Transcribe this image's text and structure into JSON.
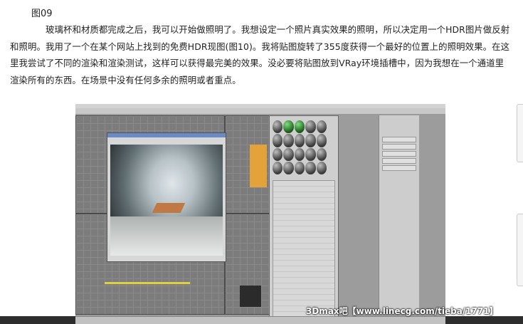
{
  "caption": "图09",
  "paragraph": "玻璃杯和材质都完成之后，我可以开始做照明了。我想设定一个照片真实效果的照明，所以决定用一个HDR图片做反射和照明。我用了一个在某个网站上找到的免费HDR现图(图10)。我将贴图旋转了355度获得一个最好的位置上的照明效果。在这里我尝试了不同的渲染和渲染测试，这样可以获得最完美的效果。没必要将贴图放到VRay环境插槽中，因为我想在一个通道里渲染所有的东西。在场景中没有任何多余的照明或者重点。",
  "watermark": "3Dmax吧【www.linecg.com/tieba/1771】"
}
